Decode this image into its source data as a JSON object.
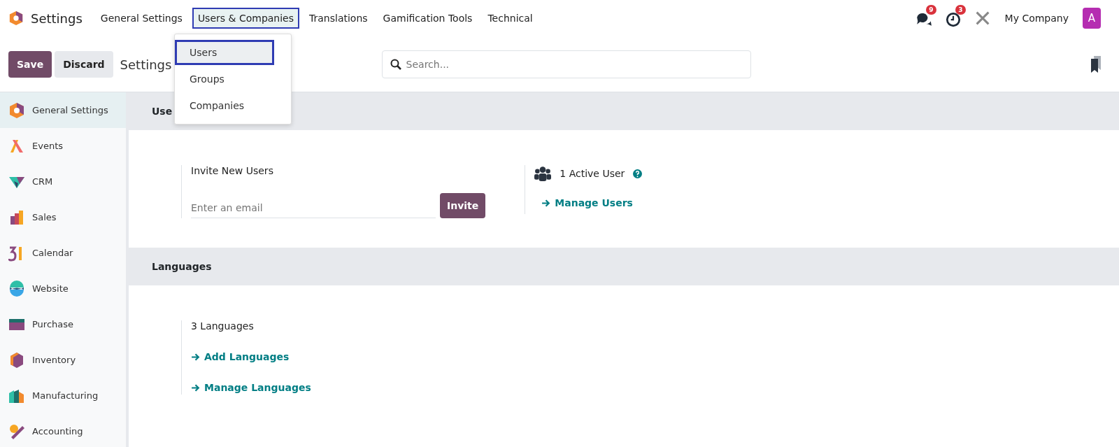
{
  "app": {
    "title": "Settings"
  },
  "nav": [
    {
      "label": "General Settings",
      "selected": false
    },
    {
      "label": "Users & Companies",
      "selected": true
    },
    {
      "label": "Translations",
      "selected": false
    },
    {
      "label": "Gamification Tools",
      "selected": false
    },
    {
      "label": "Technical",
      "selected": false
    }
  ],
  "dropdown": [
    {
      "label": "Users",
      "selected": true
    },
    {
      "label": "Groups",
      "selected": false
    },
    {
      "label": "Companies",
      "selected": false
    }
  ],
  "systray": {
    "messages_badge": "9",
    "activities_badge": "3",
    "company": "My Company",
    "avatar": "A"
  },
  "toolbar": {
    "save": "Save",
    "discard": "Discard",
    "breadcrumb": "Settings",
    "search": {
      "placeholder": "Search..."
    }
  },
  "sidebar": [
    {
      "label": "General Settings",
      "selected": true,
      "kind": "general"
    },
    {
      "label": "Events",
      "selected": false,
      "kind": "events"
    },
    {
      "label": "CRM",
      "selected": false,
      "kind": "crm"
    },
    {
      "label": "Sales",
      "selected": false,
      "kind": "sales"
    },
    {
      "label": "Calendar",
      "selected": false,
      "kind": "calendar"
    },
    {
      "label": "Website",
      "selected": false,
      "kind": "website"
    },
    {
      "label": "Purchase",
      "selected": false,
      "kind": "purchase"
    },
    {
      "label": "Inventory",
      "selected": false,
      "kind": "inventory"
    },
    {
      "label": "Manufacturing",
      "selected": false,
      "kind": "manufacturing"
    },
    {
      "label": "Accounting",
      "selected": false,
      "kind": "accounting"
    }
  ],
  "sections": [
    {
      "title": "Use",
      "blocks": [
        {
          "kind": "invite",
          "title": "Invite New Users",
          "placeholder": "Enter an email",
          "button": "Invite"
        },
        {
          "kind": "users",
          "title": "1 Active User",
          "links": [
            "Manage Users"
          ]
        }
      ]
    },
    {
      "title": "Languages",
      "blocks": [
        {
          "kind": "languages",
          "title": "3 Languages",
          "links": [
            "Add Languages",
            "Manage Languages"
          ]
        }
      ]
    }
  ]
}
